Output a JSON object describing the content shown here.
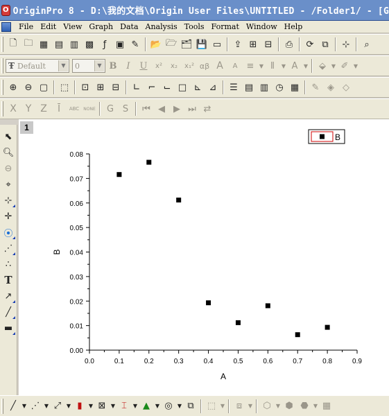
{
  "window": {
    "title": "OriginPro 8 - D:\\我的文档\\Origin User Files\\UNTITLED - /Folder1/ - [G",
    "app_icon_letter": "O"
  },
  "menu": {
    "items": [
      "File",
      "Edit",
      "View",
      "Graph",
      "Data",
      "Analysis",
      "Tools",
      "Format",
      "Window",
      "Help"
    ]
  },
  "format_toolbar": {
    "font_value": "Default",
    "size_value": "0",
    "bold": "B",
    "italic": "I",
    "underline": "U",
    "superscript": "x²",
    "subscript": "x₂",
    "supersub": "x₁²",
    "greek": "αβ",
    "increase_font": "A",
    "decrease_font": "A"
  },
  "axis_toolbar": {
    "x": "X",
    "y": "Y",
    "z": "Z",
    "err": "Ī",
    "label": "ABC",
    "none": "NONE",
    "g": "G",
    "s": "S"
  },
  "graph": {
    "layer_number": "1",
    "legend_label": "B"
  },
  "chart_data": {
    "type": "scatter",
    "title": "",
    "xlabel": "A",
    "ylabel": "B",
    "xlim": [
      0.0,
      0.9
    ],
    "ylim": [
      0.0,
      0.08
    ],
    "x_ticks": [
      "0.0",
      "0.1",
      "0.2",
      "0.3",
      "0.4",
      "0.5",
      "0.6",
      "0.7",
      "0.8",
      "0.9"
    ],
    "y_ticks": [
      "0.00",
      "0.01",
      "0.02",
      "0.03",
      "0.04",
      "0.05",
      "0.06",
      "0.07",
      "0.08"
    ],
    "grid": false,
    "legend_position": "top-right",
    "marker": "square",
    "series": [
      {
        "name": "B",
        "color": "#000000",
        "x": [
          0.1,
          0.2,
          0.3,
          0.4,
          0.5,
          0.6,
          0.7,
          0.8
        ],
        "y": [
          0.0716,
          0.0766,
          0.0612,
          0.0193,
          0.0112,
          0.0181,
          0.0063,
          0.0093
        ]
      }
    ]
  },
  "colors": {
    "titlebar": "#6a8fc9",
    "legend_border": "#cc0000",
    "marker": "#000000"
  }
}
